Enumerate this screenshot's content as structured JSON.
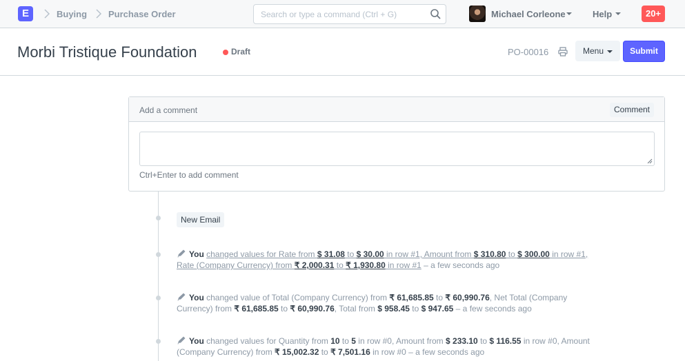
{
  "navbar": {
    "logo": "E",
    "breadcrumbs": [
      "Buying",
      "Purchase Order"
    ],
    "search_placeholder": "Search or type a command (Ctrl + G)",
    "user_name": "Michael Corleone",
    "help_label": "Help",
    "notifications": "20+"
  },
  "page": {
    "title": "Morbi Tristique Foundation",
    "status": "Draft",
    "doc_id": "PO-00016",
    "menu_label": "Menu",
    "submit_label": "Submit"
  },
  "comment": {
    "header": "Add a comment",
    "button": "Comment",
    "hint": "Ctrl+Enter to add comment"
  },
  "timeline": {
    "new_email_label": "New Email",
    "entries": [
      {
        "line1": [
          {
            "t": "You",
            "s": "b"
          },
          {
            "t": " ",
            "s": ""
          },
          {
            "t": "changed values for Rate from ",
            "s": "u"
          },
          {
            "t": "$ 31.08",
            "s": "bu"
          },
          {
            "t": " to ",
            "s": "u"
          },
          {
            "t": "$ 30.00",
            "s": "bu"
          },
          {
            "t": " in row #1, Amount from ",
            "s": "u"
          },
          {
            "t": "$ 310.80",
            "s": "bu"
          },
          {
            "t": " to ",
            "s": "u"
          },
          {
            "t": "$ 300.00",
            "s": "bu"
          },
          {
            "t": " in row #1,",
            "s": "u"
          }
        ],
        "line2": [
          {
            "t": "Rate (Company Currency) from ",
            "s": "u"
          },
          {
            "t": "₹ 2,000.31",
            "s": "bu"
          },
          {
            "t": " to ",
            "s": "u"
          },
          {
            "t": "₹ 1,930.80",
            "s": "bu"
          },
          {
            "t": " in row #1",
            "s": "u"
          },
          {
            "t": " – a few seconds ago",
            "s": ""
          }
        ]
      },
      {
        "line1": [
          {
            "t": "You",
            "s": "b"
          },
          {
            "t": " changed value of Total (Company Currency) from ",
            "s": ""
          },
          {
            "t": "₹ 61,685.85",
            "s": "b"
          },
          {
            "t": " to ",
            "s": ""
          },
          {
            "t": "₹ 60,990.76",
            "s": "b"
          },
          {
            "t": ", Net Total (Company",
            "s": ""
          }
        ],
        "line2": [
          {
            "t": "Currency) from ",
            "s": ""
          },
          {
            "t": "₹ 61,685.85",
            "s": "b"
          },
          {
            "t": " to ",
            "s": ""
          },
          {
            "t": "₹ 60,990.76",
            "s": "b"
          },
          {
            "t": ", Total from ",
            "s": ""
          },
          {
            "t": "$ 958.45",
            "s": "b"
          },
          {
            "t": " to ",
            "s": ""
          },
          {
            "t": "$ 947.65",
            "s": "b"
          },
          {
            "t": " – a few seconds ago",
            "s": ""
          }
        ]
      },
      {
        "line1": [
          {
            "t": "You",
            "s": "b"
          },
          {
            "t": " changed values for Quantity from ",
            "s": ""
          },
          {
            "t": "10",
            "s": "b"
          },
          {
            "t": " to ",
            "s": ""
          },
          {
            "t": "5",
            "s": "b"
          },
          {
            "t": " in row #0, Amount from ",
            "s": ""
          },
          {
            "t": "$ 233.10",
            "s": "b"
          },
          {
            "t": " to ",
            "s": ""
          },
          {
            "t": "$ 116.55",
            "s": "b"
          },
          {
            "t": " in row #0, Amount",
            "s": ""
          }
        ],
        "line2": [
          {
            "t": "(Company Currency) from ",
            "s": ""
          },
          {
            "t": "₹ 15,002.32",
            "s": "b"
          },
          {
            "t": " to ",
            "s": ""
          },
          {
            "t": "₹ 7,501.16",
            "s": "b"
          },
          {
            "t": " in row #0",
            "s": ""
          },
          {
            "t": " – a few seconds ago",
            "s": ""
          }
        ]
      }
    ]
  },
  "colors": {
    "primary": "#5e64ff",
    "danger": "#ff5858",
    "border": "#d1d8dd",
    "muted": "#8d99a6"
  }
}
